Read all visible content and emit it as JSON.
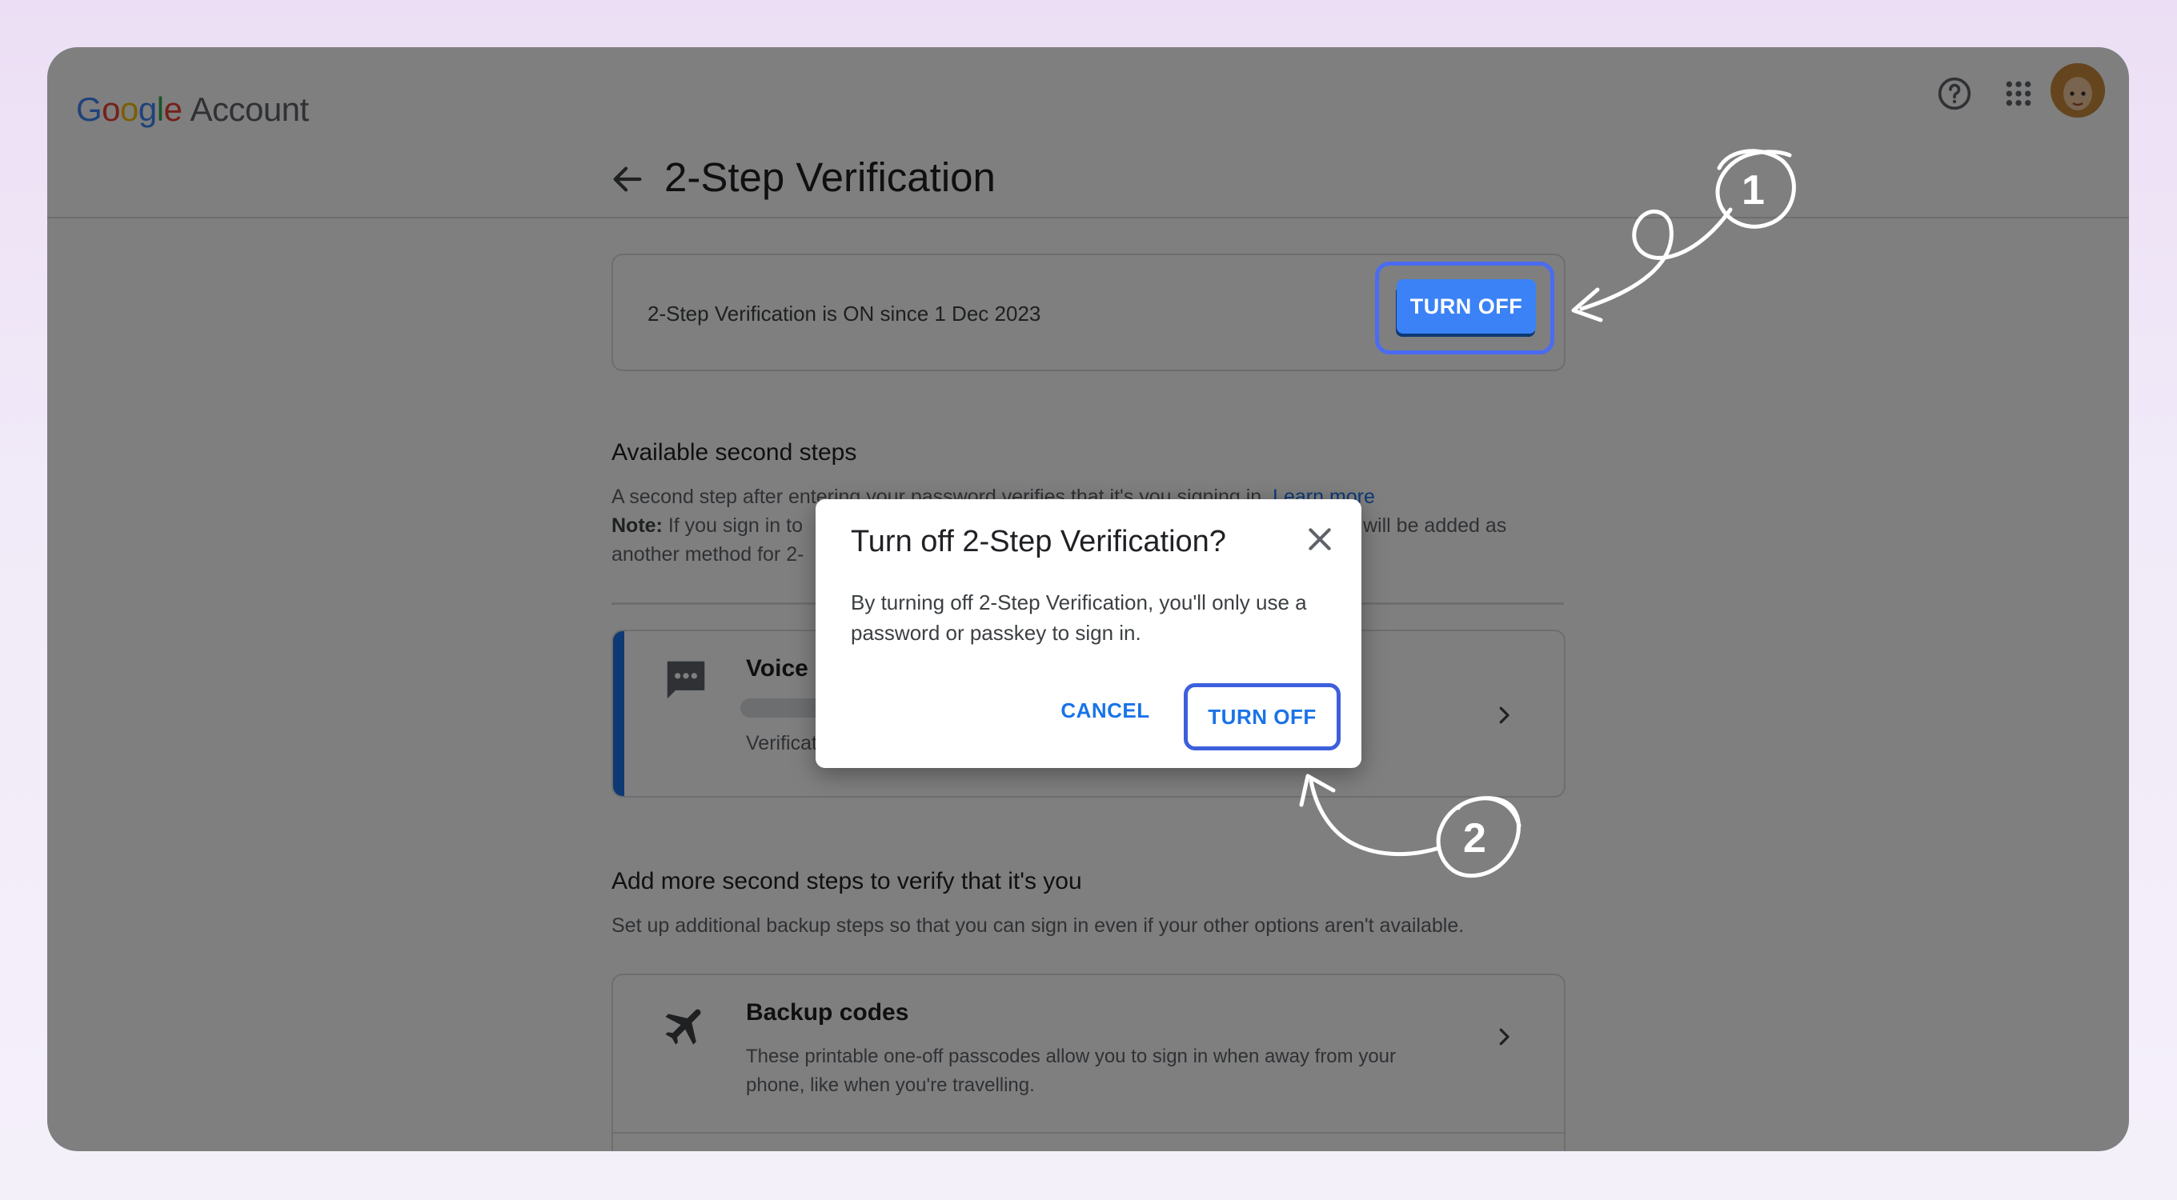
{
  "header": {
    "logo_google": [
      "G",
      "o",
      "o",
      "g",
      "l",
      "e"
    ],
    "logo_account": "Account",
    "help_icon": "help-circle-icon",
    "apps_icon": "apps-grid-icon",
    "avatar": "user-avatar"
  },
  "page": {
    "title": "2-Step Verification",
    "back_icon": "back-arrow-icon"
  },
  "status_card": {
    "text": "2-Step Verification is ON since 1 Dec 2023",
    "button_label": "TURN OFF"
  },
  "available": {
    "title": "Available second steps",
    "line1_prefix": "A second step after entering your password verifies that it's you signing in.",
    "line1_link": "Learn more",
    "note_label": "Note:",
    "line2_left": "If you sign in to",
    "line2_right": "will be added as",
    "line3": "another method for 2-"
  },
  "voice_card": {
    "title": "Voice",
    "subtitle": "Verificat",
    "icon": "message-dots-icon"
  },
  "add_more": {
    "title": "Add more second steps to verify that it's you",
    "description": "Set up additional backup steps so that you can sign in even if your other options aren't available."
  },
  "backup_card": {
    "title": "Backup codes",
    "description": "These printable one-off passcodes allow you to sign in when away from your phone, like when you're travelling.",
    "icon": "airplane-icon"
  },
  "dialog": {
    "title": "Turn off 2-Step Verification?",
    "body": "By turning off 2-Step Verification, you'll only use a password or passkey to sign in.",
    "cancel_label": "CANCEL",
    "confirm_label": "TURN OFF"
  },
  "annotations": {
    "step1": "1",
    "step2": "2",
    "color": "#ffffff",
    "highlight_color": "#4a6cf2"
  }
}
